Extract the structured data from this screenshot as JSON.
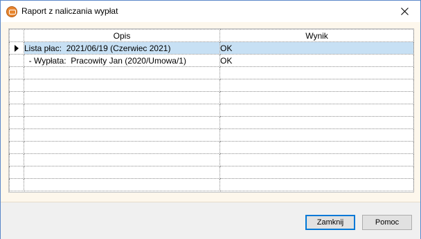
{
  "window": {
    "title": "Raport z naliczania wypłat"
  },
  "grid": {
    "columns": [
      "",
      "Opis",
      "Wynik"
    ],
    "rows": [
      {
        "indicator": true,
        "desc": "Lista płac:  2021/06/19 (Czerwiec 2021)",
        "result": "OK",
        "selected": true
      },
      {
        "indicator": false,
        "desc": "  - Wypłata:  Pracowity Jan (2020/Umowa/1)",
        "result": "OK",
        "selected": false
      },
      {
        "indicator": false,
        "desc": "",
        "result": ""
      },
      {
        "indicator": false,
        "desc": "",
        "result": ""
      },
      {
        "indicator": false,
        "desc": "",
        "result": ""
      },
      {
        "indicator": false,
        "desc": "",
        "result": ""
      },
      {
        "indicator": false,
        "desc": "",
        "result": ""
      },
      {
        "indicator": false,
        "desc": "",
        "result": ""
      },
      {
        "indicator": false,
        "desc": "",
        "result": ""
      },
      {
        "indicator": false,
        "desc": "",
        "result": ""
      },
      {
        "indicator": false,
        "desc": "",
        "result": ""
      },
      {
        "indicator": false,
        "desc": "",
        "result": ""
      }
    ]
  },
  "buttons": {
    "close": "Zamknij",
    "help": "Pomoc"
  },
  "icons": {
    "app": "app-logo-icon",
    "close": "close-icon",
    "row_pointer": "row-pointer-icon"
  },
  "colors": {
    "selection": "#c7e0f4",
    "window_border": "#5a87c9",
    "client_bg": "#fdf7ec"
  }
}
